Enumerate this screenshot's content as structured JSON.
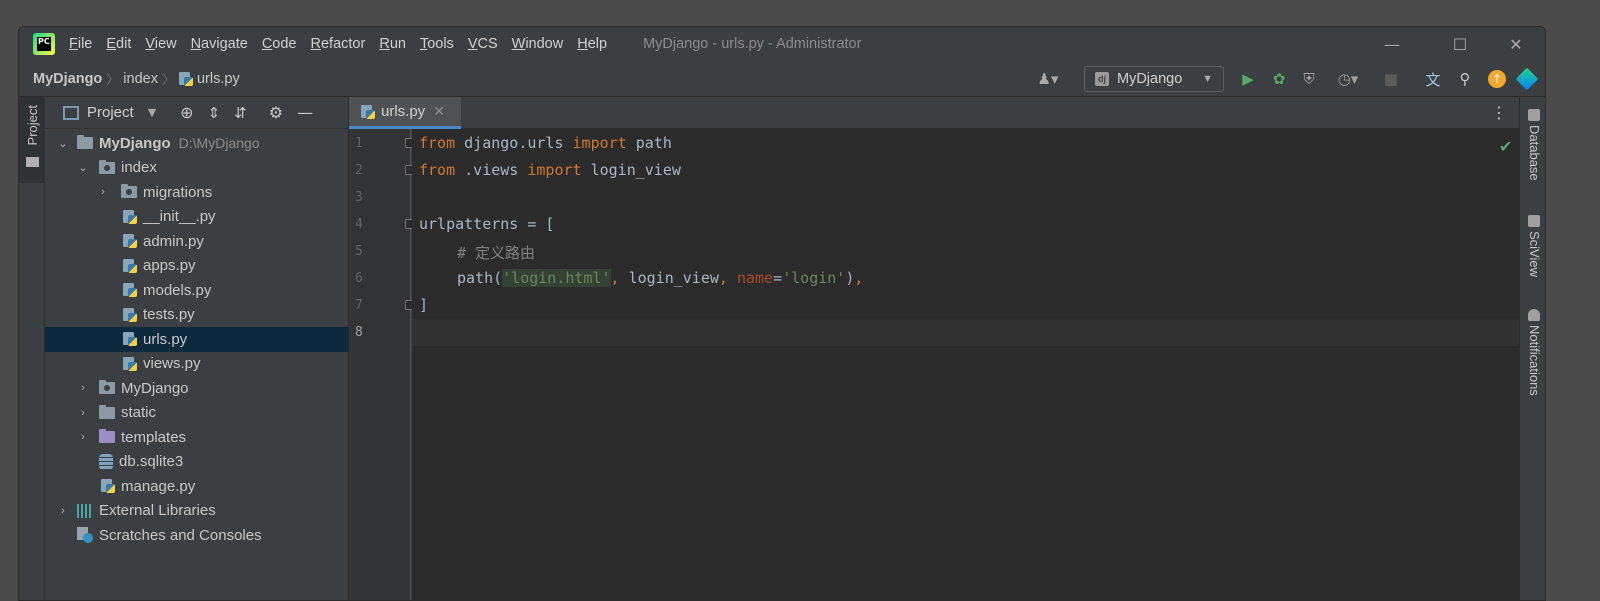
{
  "app": {
    "menu": [
      "File",
      "Edit",
      "View",
      "Navigate",
      "Code",
      "Refactor",
      "Run",
      "Tools",
      "VCS",
      "Window",
      "Help"
    ],
    "window_title": "MyDjango - urls.py - Administrator"
  },
  "breadcrumb": {
    "project": "MyDjango",
    "folder": "index",
    "file": "urls.py"
  },
  "run_config": {
    "label": "MyDjango"
  },
  "left_stripe": {
    "project_label": "Project"
  },
  "project_panel": {
    "title": "Project",
    "tree": [
      {
        "label": "MyDjango",
        "path": "D:\\MyDjango"
      },
      {
        "label": "index"
      },
      {
        "label": "migrations"
      },
      {
        "label": "__init__.py"
      },
      {
        "label": "admin.py"
      },
      {
        "label": "apps.py"
      },
      {
        "label": "models.py"
      },
      {
        "label": "tests.py"
      },
      {
        "label": "urls.py"
      },
      {
        "label": "views.py"
      },
      {
        "label": "MyDjango"
      },
      {
        "label": "static"
      },
      {
        "label": "templates"
      },
      {
        "label": "db.sqlite3"
      },
      {
        "label": "manage.py"
      },
      {
        "label": "External Libraries"
      },
      {
        "label": "Scratches and Consoles"
      }
    ]
  },
  "editor": {
    "tab": "urls.py",
    "line_numbers": [
      "1",
      "2",
      "3",
      "4",
      "5",
      "6",
      "7",
      "8"
    ],
    "current_line": "8",
    "code": {
      "l1": {
        "kw1": "from",
        "mid": " django.urls ",
        "kw2": "import",
        "end": " path"
      },
      "l2": {
        "kw1": "from",
        "mid": " .views ",
        "kw2": "import",
        "end": " login_view"
      },
      "l4": {
        "text": "urlpatterns = ["
      },
      "l5": {
        "comment": "# 定义路由"
      },
      "l6": {
        "p1": "path(",
        "s1": "'login.html'",
        "c1": ", ",
        "p2": "login_view",
        "c2": ", ",
        "named": "name",
        "eq": "=",
        "s2": "'login'",
        "p3": ")",
        "c3": ","
      },
      "l7": {
        "text": "]"
      }
    }
  },
  "right_stripe": {
    "tools": [
      "Database",
      "SciView",
      "Notifications"
    ]
  },
  "colors": {
    "accent": "#4a88c7",
    "keyword": "#cc7832",
    "string": "#6a8759",
    "selection": "#0d293e"
  }
}
